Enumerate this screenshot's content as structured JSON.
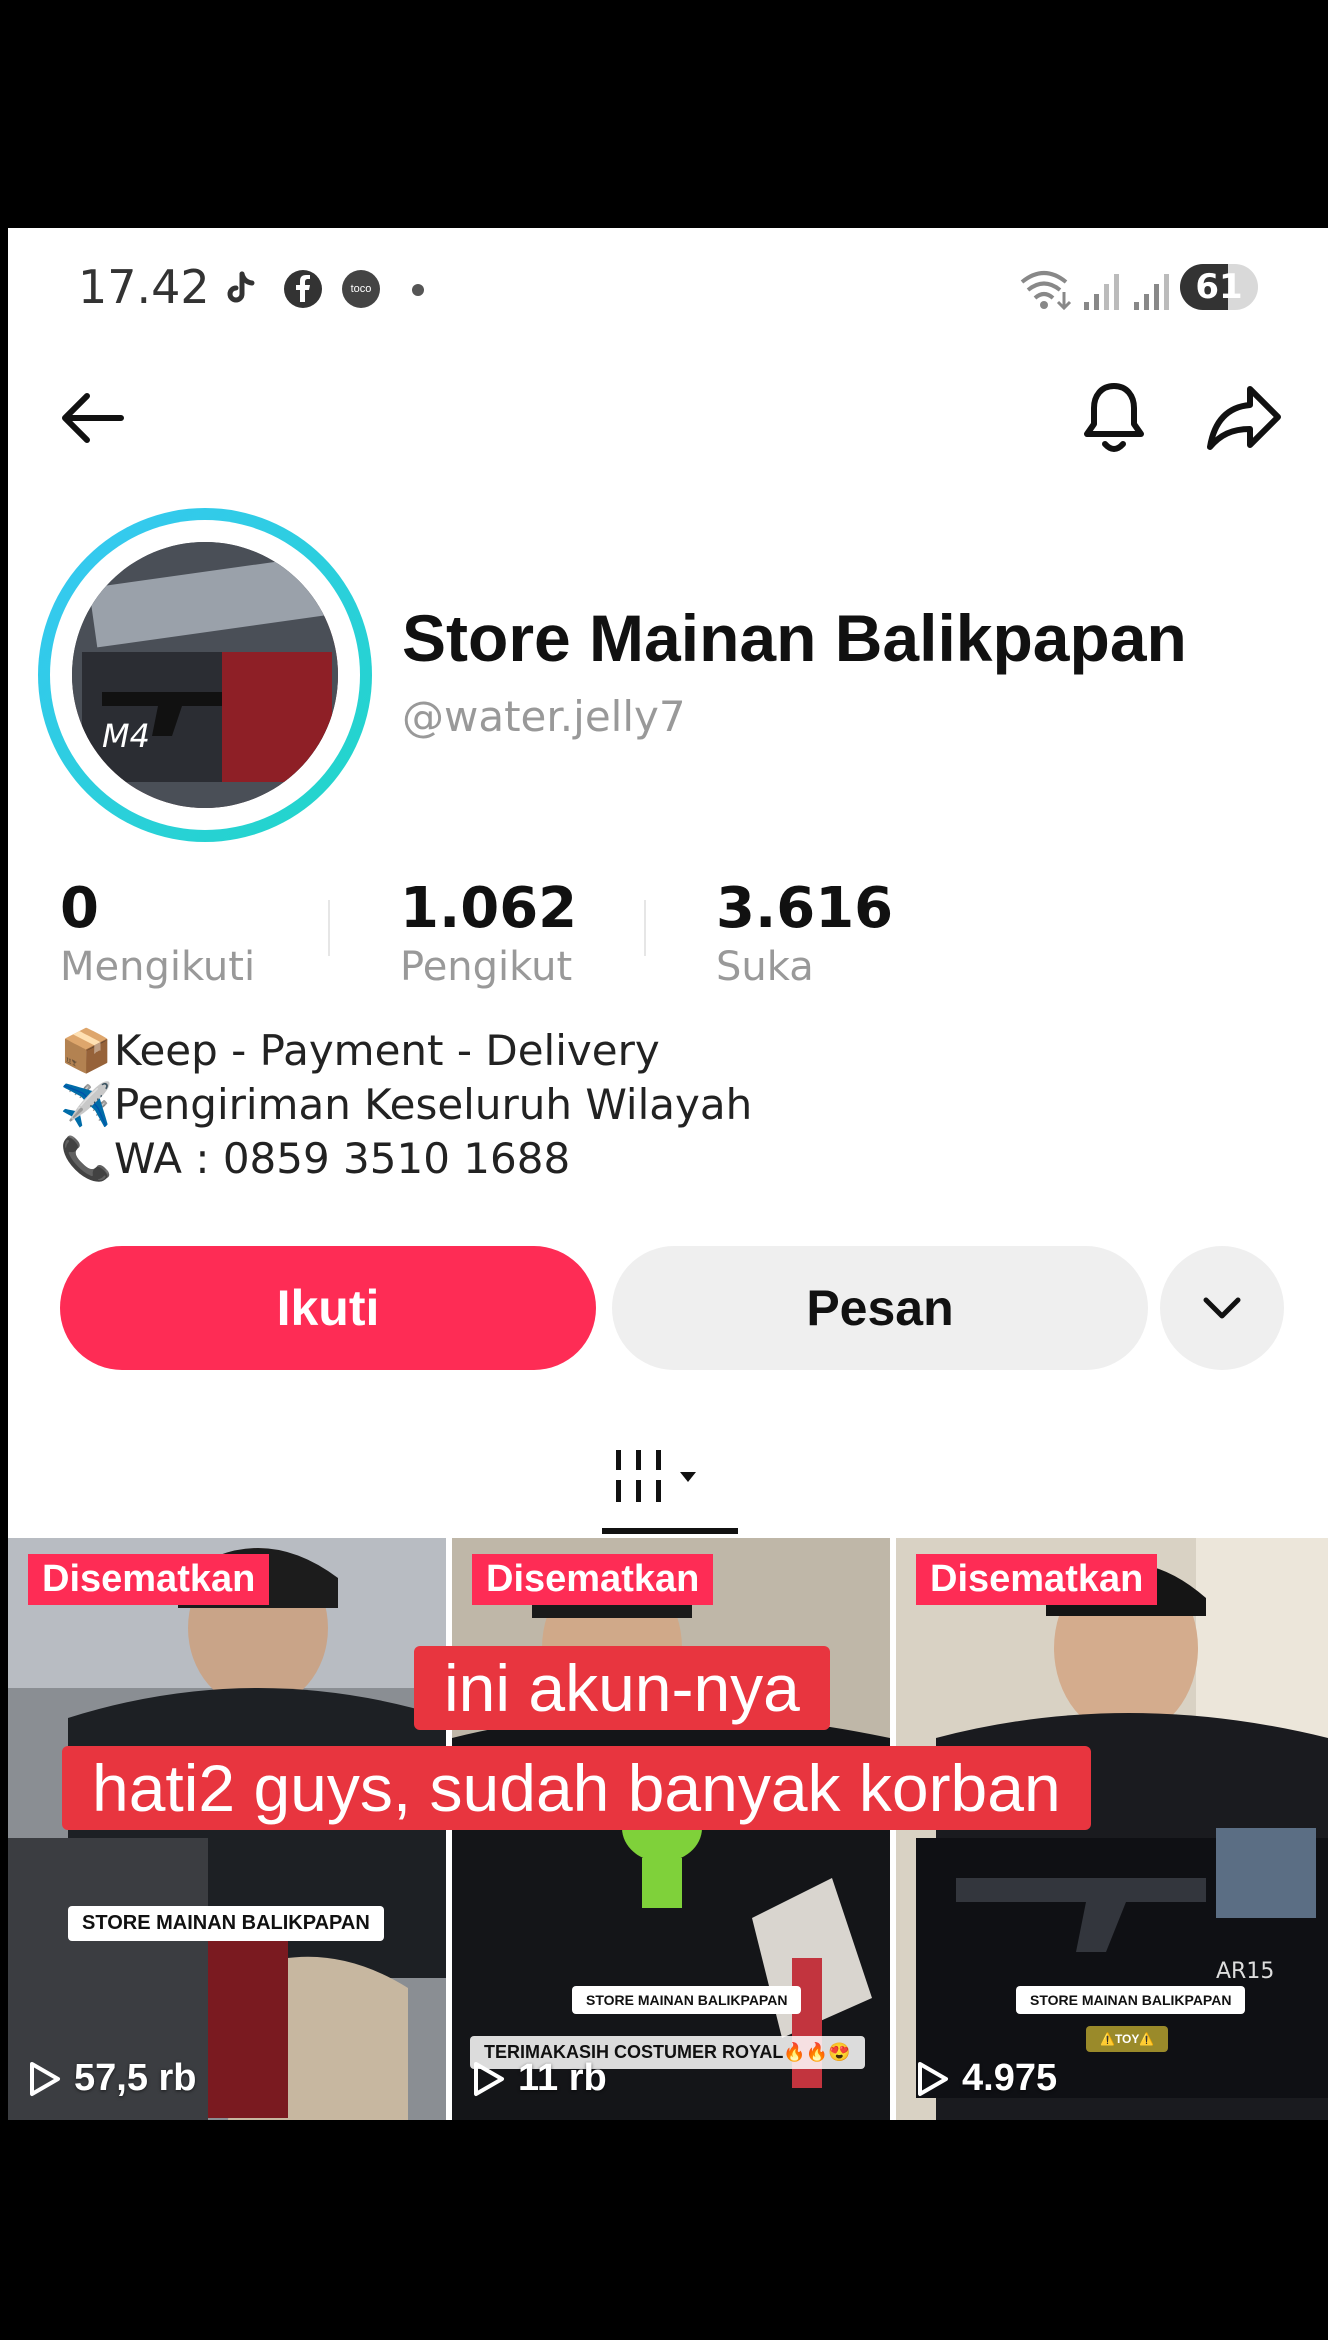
{
  "status_bar": {
    "time": "17.42",
    "notification_icons": [
      "tiktok-icon",
      "facebook-icon",
      "toco-icon",
      "dot-icon"
    ],
    "toco_label": "toco",
    "system_icons": [
      "wifi-icon",
      "signal-icon",
      "signal-icon"
    ],
    "battery": "61",
    "battery_level": 61
  },
  "header": {
    "back_icon": "arrow-left-icon",
    "bell_icon": "bell-icon",
    "share_icon": "share-icon"
  },
  "profile": {
    "name": "Store Mainan Balikpapan",
    "handle": "@water.jelly7",
    "avatar_ring_color": "#2ccbe0"
  },
  "stats": [
    {
      "value": "0",
      "label": "Mengikuti"
    },
    {
      "value": "1.062",
      "label": "Pengikut"
    },
    {
      "value": "3.616",
      "label": "Suka"
    }
  ],
  "bio": [
    {
      "emoji": "📦",
      "text": "Keep - Payment - Delivery"
    },
    {
      "emoji": "✈️",
      "text": "Pengiriman Keseluruh Wilayah"
    },
    {
      "emoji": "📞",
      "text": "WA : 0859 3510 1688"
    }
  ],
  "actions": {
    "follow": "Ikuti",
    "message": "Pesan",
    "follow_color": "#fe2c55"
  },
  "tabs": {
    "active": "grid-icon"
  },
  "videos": [
    {
      "pinned": "Disematkan",
      "views": "57,5 rb",
      "label": "STORE MAINAN BALIKPAPAN"
    },
    {
      "pinned": "Disematkan",
      "views": "11 rb",
      "label": "STORE MAINAN BALIKPAPAN",
      "caption": "TERIMAKASIH COSTUMER ROYAL🔥🔥😍"
    },
    {
      "pinned": "Disematkan",
      "views": "4.975",
      "label": "STORE MAINAN BALIKPAPAN",
      "sub_label": "⚠️TOY⚠️",
      "box_text": "AR15"
    }
  ],
  "overlay": {
    "line1": "ini akun-nya",
    "line2": "hati2 guys, sudah banyak korban"
  }
}
